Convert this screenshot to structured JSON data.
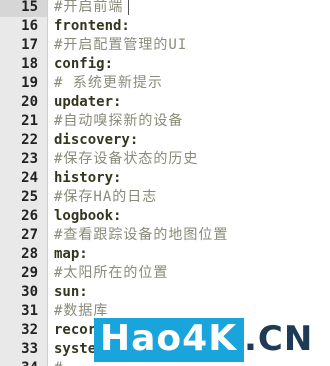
{
  "editor": {
    "lines": [
      {
        "number": "15",
        "text": "#开启前端",
        "kind": "comment"
      },
      {
        "number": "16",
        "text": "frontend:",
        "kind": "key"
      },
      {
        "number": "17",
        "text": "#开启配置管理的UI",
        "kind": "comment"
      },
      {
        "number": "18",
        "text": "config:",
        "kind": "key"
      },
      {
        "number": "19",
        "text": "# 系统更新提示",
        "kind": "comment"
      },
      {
        "number": "20",
        "text": "updater:",
        "kind": "key"
      },
      {
        "number": "21",
        "text": "#自动嗅探新的设备",
        "kind": "comment"
      },
      {
        "number": "22",
        "text": "discovery:",
        "kind": "key"
      },
      {
        "number": "23",
        "text": "#保存设备状态的历史",
        "kind": "comment"
      },
      {
        "number": "24",
        "text": "history:",
        "kind": "key"
      },
      {
        "number": "25",
        "text": "#保存HA的日志",
        "kind": "comment"
      },
      {
        "number": "26",
        "text": "logbook:",
        "kind": "key"
      },
      {
        "number": "27",
        "text": "#查看跟踪设备的地图位置",
        "kind": "comment"
      },
      {
        "number": "28",
        "text": "map:",
        "kind": "key"
      },
      {
        "number": "29",
        "text": "#太阳所在的位置",
        "kind": "comment"
      },
      {
        "number": "30",
        "text": "sun:",
        "kind": "key"
      },
      {
        "number": "31",
        "text": "#数据库",
        "kind": "comment"
      },
      {
        "number": "32",
        "text": "recorder:",
        "kind": "key"
      },
      {
        "number": "33",
        "text": "system_health:",
        "kind": "key"
      },
      {
        "number": "34",
        "text": "#",
        "kind": "comment"
      }
    ]
  },
  "watermark": {
    "brand": "Hao4K",
    "suffix": ".CN"
  },
  "colors": {
    "gutter_bg": "#e9e9e9",
    "comment": "#8a8a7a",
    "keyword": "#35361f",
    "watermark_blue": "#1aa4dc",
    "watermark_dark": "#1f3a57"
  }
}
